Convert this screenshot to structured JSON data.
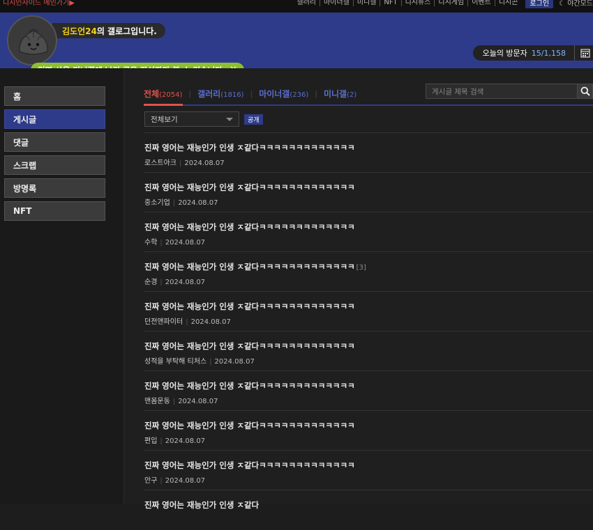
{
  "topbar": {
    "main_link": "디시인사이드 메인가기",
    "nav": [
      "갤러리",
      "마이너갤",
      "미니갤",
      "NFT",
      "디시뉴스",
      "디시게임",
      "이벤트",
      "디시콘"
    ],
    "login": "로그인",
    "night_mode": "야간모드"
  },
  "header": {
    "owner_nick": "김도언24",
    "owner_suffix": "의 갤로그입니다.",
    "visitors_label": "오늘의 방문자",
    "visitors_count": "15/1,158",
    "notice": "익명 사용 미니갤에 남긴 글은 작성자만 볼 수 있습니다."
  },
  "sidebar": {
    "items": [
      "홈",
      "게시글",
      "댓글",
      "스크랩",
      "방명록",
      "NFT"
    ],
    "active_index": 1
  },
  "tabs": [
    {
      "label": "전체",
      "count": "(2054)"
    },
    {
      "label": "갤러리",
      "count": "(1816)"
    },
    {
      "label": "마이너갤",
      "count": "(236)"
    },
    {
      "label": "미니갤",
      "count": "(2)"
    }
  ],
  "search": {
    "placeholder": "게시글 제목 검색"
  },
  "filter": {
    "selected": "전체보기",
    "badge": "공개"
  },
  "posts": [
    {
      "title": "진짜 영어는 재능인가 인생 ㅈ같다ㅋㅋㅋㅋㅋㅋㅋㅋㅋㅋㅋㅋㅋ",
      "reply": "",
      "gallery": "로스트아크",
      "date": "2024.08.07"
    },
    {
      "title": "진짜 영어는 재능인가 인생 ㅈ같다ㅋㅋㅋㅋㅋㅋㅋㅋㅋㅋㅋㅋㅋ",
      "reply": "",
      "gallery": "중소기업",
      "date": "2024.08.07"
    },
    {
      "title": "진짜 영어는 재능인가 인생 ㅈ같다ㅋㅋㅋㅋㅋㅋㅋㅋㅋㅋㅋㅋㅋ",
      "reply": "",
      "gallery": "수학",
      "date": "2024.08.07"
    },
    {
      "title": "진짜 영어는 재능인가 인생 ㅈ같다ㅋㅋㅋㅋㅋㅋㅋㅋㅋㅋㅋㅋㅋ",
      "reply": "[3]",
      "gallery": "순경",
      "date": "2024.08.07"
    },
    {
      "title": "진짜 영어는 재능인가 인생 ㅈ같다ㅋㅋㅋㅋㅋㅋㅋㅋㅋㅋㅋㅋㅋ",
      "reply": "",
      "gallery": "던전앤파이터",
      "date": "2024.08.07"
    },
    {
      "title": "진짜 영어는 재능인가 인생 ㅈ같다ㅋㅋㅋㅋㅋㅋㅋㅋㅋㅋㅋㅋㅋ",
      "reply": "",
      "gallery": "성적을 부탁해 티처스",
      "date": "2024.08.07"
    },
    {
      "title": "진짜 영어는 재능인가 인생 ㅈ같다ㅋㅋㅋㅋㅋㅋㅋㅋㅋㅋㅋㅋㅋ",
      "reply": "",
      "gallery": "맨몸운동",
      "date": "2024.08.07"
    },
    {
      "title": "진짜 영어는 재능인가 인생 ㅈ같다ㅋㅋㅋㅋㅋㅋㅋㅋㅋㅋㅋㅋㅋ",
      "reply": "",
      "gallery": "편입",
      "date": "2024.08.07"
    },
    {
      "title": "진짜 영어는 재능인가 인생 ㅈ같다ㅋㅋㅋㅋㅋㅋㅋㅋㅋㅋㅋㅋㅋ",
      "reply": "",
      "gallery": "안구",
      "date": "2024.08.07"
    },
    {
      "title": "진짜 영어는 재능인가 인생 ㅈ같다",
      "reply": "",
      "gallery": "",
      "date": ""
    }
  ],
  "colors": {
    "header_bg": "#2e3b8b",
    "active_tab": "#e0524c",
    "tab_link": "#5a6fd0",
    "notice_bg": "#8dbf2f",
    "nick": "#f5d21a"
  },
  "icons": [
    "avatar-mascot",
    "close-icon",
    "calendar-icon",
    "search-icon",
    "chevron-down-icon",
    "moon-icon",
    "triangle-right-icon"
  ]
}
